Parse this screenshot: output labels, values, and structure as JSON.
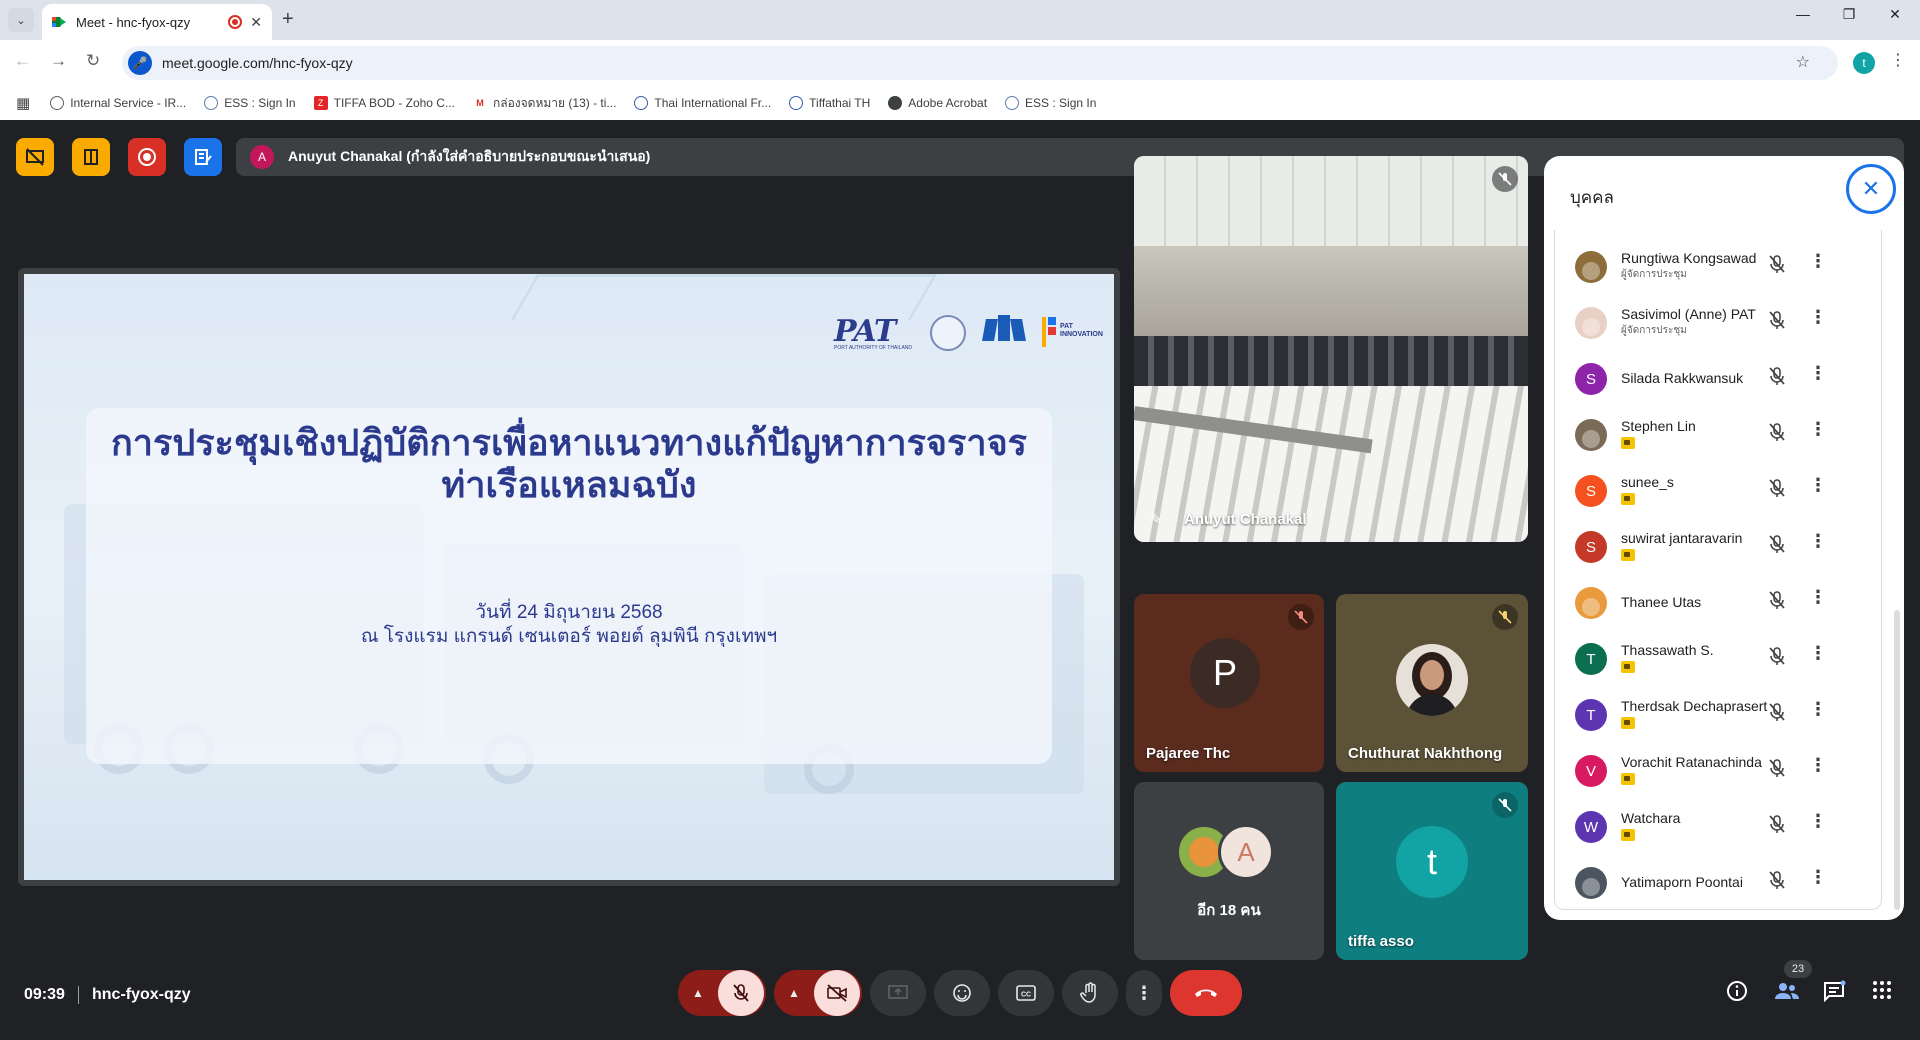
{
  "browser": {
    "tab_title": "Meet - hnc-fyox-qzy",
    "url": "meet.google.com/hnc-fyox-qzy",
    "profile_initial": "t",
    "bookmarks": [
      {
        "label": "Internal Service - IR...",
        "icon": "globe-icon"
      },
      {
        "label": "ESS : Sign In",
        "icon": "ess-icon"
      },
      {
        "label": "TIFFA BOD - Zoho C...",
        "icon": "zoho-icon"
      },
      {
        "label": "กล่องจดหมาย (13) - ti...",
        "icon": "gmail-icon"
      },
      {
        "label": "Thai International Fr...",
        "icon": "globe-icon"
      },
      {
        "label": "Tiffathai TH",
        "icon": "globe-icon"
      },
      {
        "label": "Adobe Acrobat",
        "icon": "acrobat-icon"
      },
      {
        "label": "ESS : Sign In",
        "icon": "ess-icon"
      }
    ]
  },
  "meet": {
    "presenter_initial": "A",
    "presentation_banner": "Anuyut Chanakal (กำลังใส่คำอธิบายประกอบขณะนำเสนอ)",
    "slide": {
      "logo_text": "PAT",
      "logo_sub": "PORT AUTHORITY OF THAILAND",
      "logo_inno": "PAT INNOVATION",
      "title_line1": "การประชุมเชิงปฏิบัติการเพื่อหาแนวทางแก้ปัญหาการจราจร",
      "title_line2": "ท่าเรือแหลมฉบัง",
      "date_line": "วันที่ 24 มิถุนายน 2568",
      "venue_line": "ณ โรงแรม แกรนด์ เซนเตอร์ พอยต์ ลุมพินี กรุงเทพฯ"
    },
    "tiles": {
      "main_speaker": "Anuyut Chanakal",
      "tile2": {
        "name": "Pajaree Thc",
        "initial": "P"
      },
      "tile3": {
        "name": "Chuthurat Nakhthong"
      },
      "tile4": {
        "label": "อีก 18 คน"
      },
      "tile5": {
        "name": "tiffa asso",
        "initial": "t"
      }
    },
    "people_panel": {
      "title": "บุคคล",
      "people": [
        {
          "name": "Rungtiwa Kongsawad",
          "role": "ผู้จัดการประชุม",
          "avatar": "photo",
          "color": "#8d6e3a"
        },
        {
          "name": "Sasivimol (Anne) PAT",
          "role": "ผู้จัดการประชุม",
          "avatar": "photo",
          "color": "#e8d0c4"
        },
        {
          "name": "Silada Rakkwansuk",
          "role": "",
          "avatar": "S",
          "color": "#8e24aa"
        },
        {
          "name": "Stephen Lin",
          "role": "",
          "avatar": "photo",
          "color": "#7b6a58",
          "badge": true
        },
        {
          "name": "sunee_s",
          "role": "",
          "avatar": "S",
          "color": "#f4511e",
          "badge": true
        },
        {
          "name": "suwirat jantaravarin",
          "role": "",
          "avatar": "S",
          "color": "#c53929",
          "badge": true
        },
        {
          "name": "Thanee Utas",
          "role": "",
          "avatar": "photo",
          "color": "#e89a3c"
        },
        {
          "name": "Thassawath S.",
          "role": "",
          "avatar": "T",
          "color": "#0b6e4f",
          "badge": true
        },
        {
          "name": "Therdsak Dechaprasert",
          "role": "",
          "avatar": "T",
          "color": "#5e35b1",
          "badge": true
        },
        {
          "name": "Vorachit Ratanachinda",
          "role": "",
          "avatar": "V",
          "color": "#d81b60",
          "badge": true
        },
        {
          "name": "Watchara",
          "role": "",
          "avatar": "W",
          "color": "#5e35b1",
          "badge": true
        },
        {
          "name": "Yatimaporn Poontai",
          "role": "",
          "avatar": "photo",
          "color": "#4a5560"
        }
      ]
    },
    "bottom": {
      "time": "09:39",
      "meeting_code": "hnc-fyox-qzy",
      "people_count": "23"
    }
  }
}
